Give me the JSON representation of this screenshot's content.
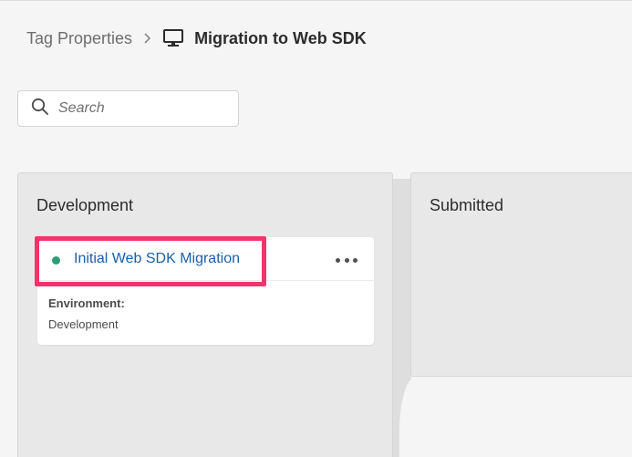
{
  "breadcrumb": {
    "parent": "Tag Properties",
    "separator_icon": "chevron-right-icon",
    "property_icon": "monitor-icon",
    "current": "Migration to Web SDK"
  },
  "search": {
    "placeholder": "Search",
    "value": "",
    "icon": "search-icon"
  },
  "columns": [
    {
      "title": "Development",
      "cards": [
        {
          "title": "Initial Web SDK Migration",
          "status_color": "#2d9d78",
          "menu_icon": "more-horizontal-icon",
          "highlighted": true,
          "highlight_color": "#f0356c",
          "field_label": "Environment:",
          "field_value": "Development"
        }
      ]
    },
    {
      "title": "Submitted",
      "cards": []
    }
  ],
  "colors": {
    "background": "#f5f5f5",
    "column": "#e8e8e8",
    "link": "#1a5fa8"
  }
}
